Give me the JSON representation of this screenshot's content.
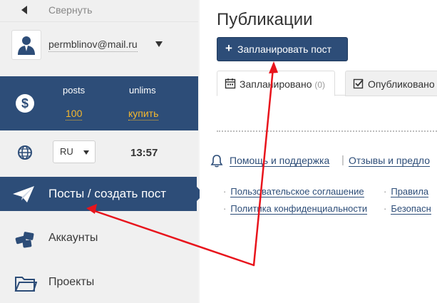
{
  "sidebar": {
    "collapse_label": "Свернуть",
    "user_email": "permblinov@mail.ru",
    "stats": {
      "posts_label": "posts",
      "posts_value": "100",
      "plan_label": "unlims",
      "plan_value": "купить"
    },
    "language": "RU",
    "time": "13:57",
    "nav": [
      {
        "label": "Посты / создать пост",
        "icon": "paper-plane-icon",
        "active": true
      },
      {
        "label": "Аккаунты",
        "icon": "accounts-icon",
        "active": false
      },
      {
        "label": "Проекты",
        "icon": "folder-icon",
        "active": false
      }
    ]
  },
  "main": {
    "title": "Публикации",
    "plan_button": "Запланировать пост",
    "tabs": [
      {
        "label": "Запланировано",
        "count": "(0)",
        "icon": "calendar-icon"
      },
      {
        "label": "Опубликовано",
        "icon": "checkbox-icon"
      }
    ],
    "help_link": "Помощь и поддержка",
    "help_separator": "|",
    "reviews_link": "Отзывы и предло",
    "footer_links": [
      "Пользовательское соглашение",
      "Политика конфиденциальности",
      "Правила",
      "Безопасн"
    ]
  },
  "colors": {
    "brand": "#2d4d78",
    "accent_yellow": "#f5b82e",
    "annotation_red": "#e8141c"
  }
}
